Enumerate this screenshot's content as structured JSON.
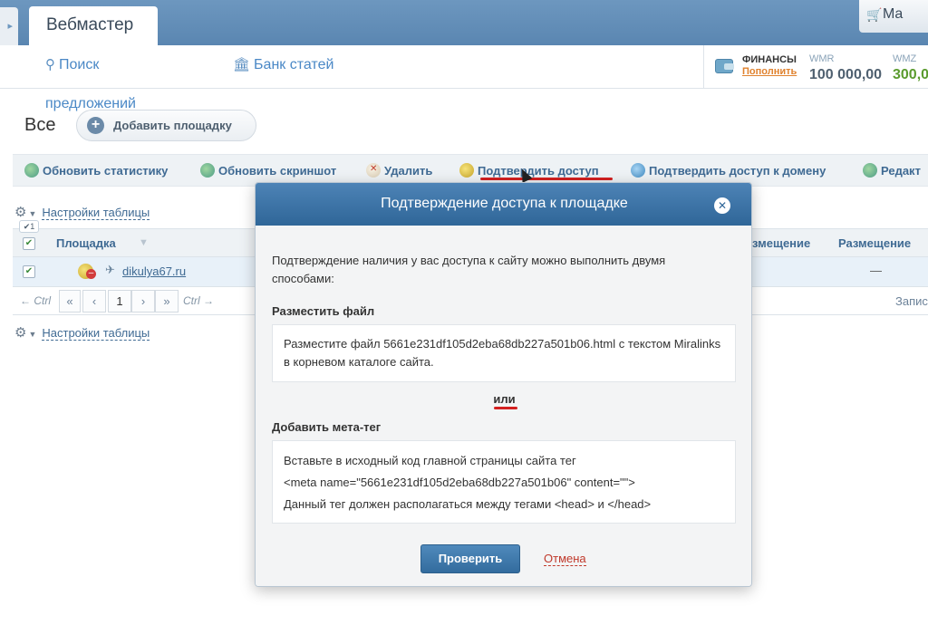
{
  "top": {
    "tab_label": "Вебмастер",
    "cart_label": "Ma"
  },
  "nav": {
    "search_label": "Поиск",
    "articles_label": "Банк статей",
    "offers_label": "предложений"
  },
  "finance": {
    "title": "ФИНАНСЫ",
    "topup": "Пополнить",
    "wmr_label": "WMR",
    "wmr_value": "100 000,00",
    "wmz_label": "WMZ",
    "wmz_value": "300,0",
    "wmr_color": "#4f6070",
    "wmz_color": "#5a9b2e"
  },
  "page": {
    "title": "Все",
    "add_site": "Добавить площадку"
  },
  "toolbar": {
    "update_stats": "Обновить статистику",
    "update_screenshot": "Обновить скриншот",
    "delete": "Удалить",
    "confirm_access": "Подтвердить доступ",
    "confirm_domain": "Подтвердить доступ к домену",
    "edit": "Редакт"
  },
  "table": {
    "settings_label": "Настройки таблицы",
    "selected_count": "✔1",
    "col_site": "Площадка",
    "col_placement_1": "змещение",
    "col_placement_2": "Размещение",
    "rows": [
      {
        "site": "dikulya67.ru",
        "placement": "—"
      }
    ]
  },
  "pager": {
    "prev_ctrl": "← Ctrl",
    "first": "«",
    "prev": "‹",
    "page": "1",
    "next": "›",
    "last": "»",
    "next_ctrl": "Ctrl →",
    "right_text": "Запис"
  },
  "modal": {
    "title": "Подтверждение доступа к площадке",
    "close": "✕",
    "intro": "Подтверждение наличия у вас доступа к сайту можно выполнить двумя способами:",
    "file_section": "Разместить файл",
    "file_text": "Разместите файл 5661e231df105d2eba68db227a501b06.html с текстом Miralinks в корневом каталоге сайта.",
    "or": "или",
    "meta_section": "Добавить мета-тег",
    "meta_line1": "Вставьте в исходный код главной страницы сайта тег",
    "meta_line2": "<meta name=\"5661e231df105d2eba68db227a501b06\" content=\"\">",
    "meta_line3": "Данный тег должен располагаться между тегами <head> и </head>",
    "check_button": "Проверить",
    "cancel_button": "Отмена"
  }
}
